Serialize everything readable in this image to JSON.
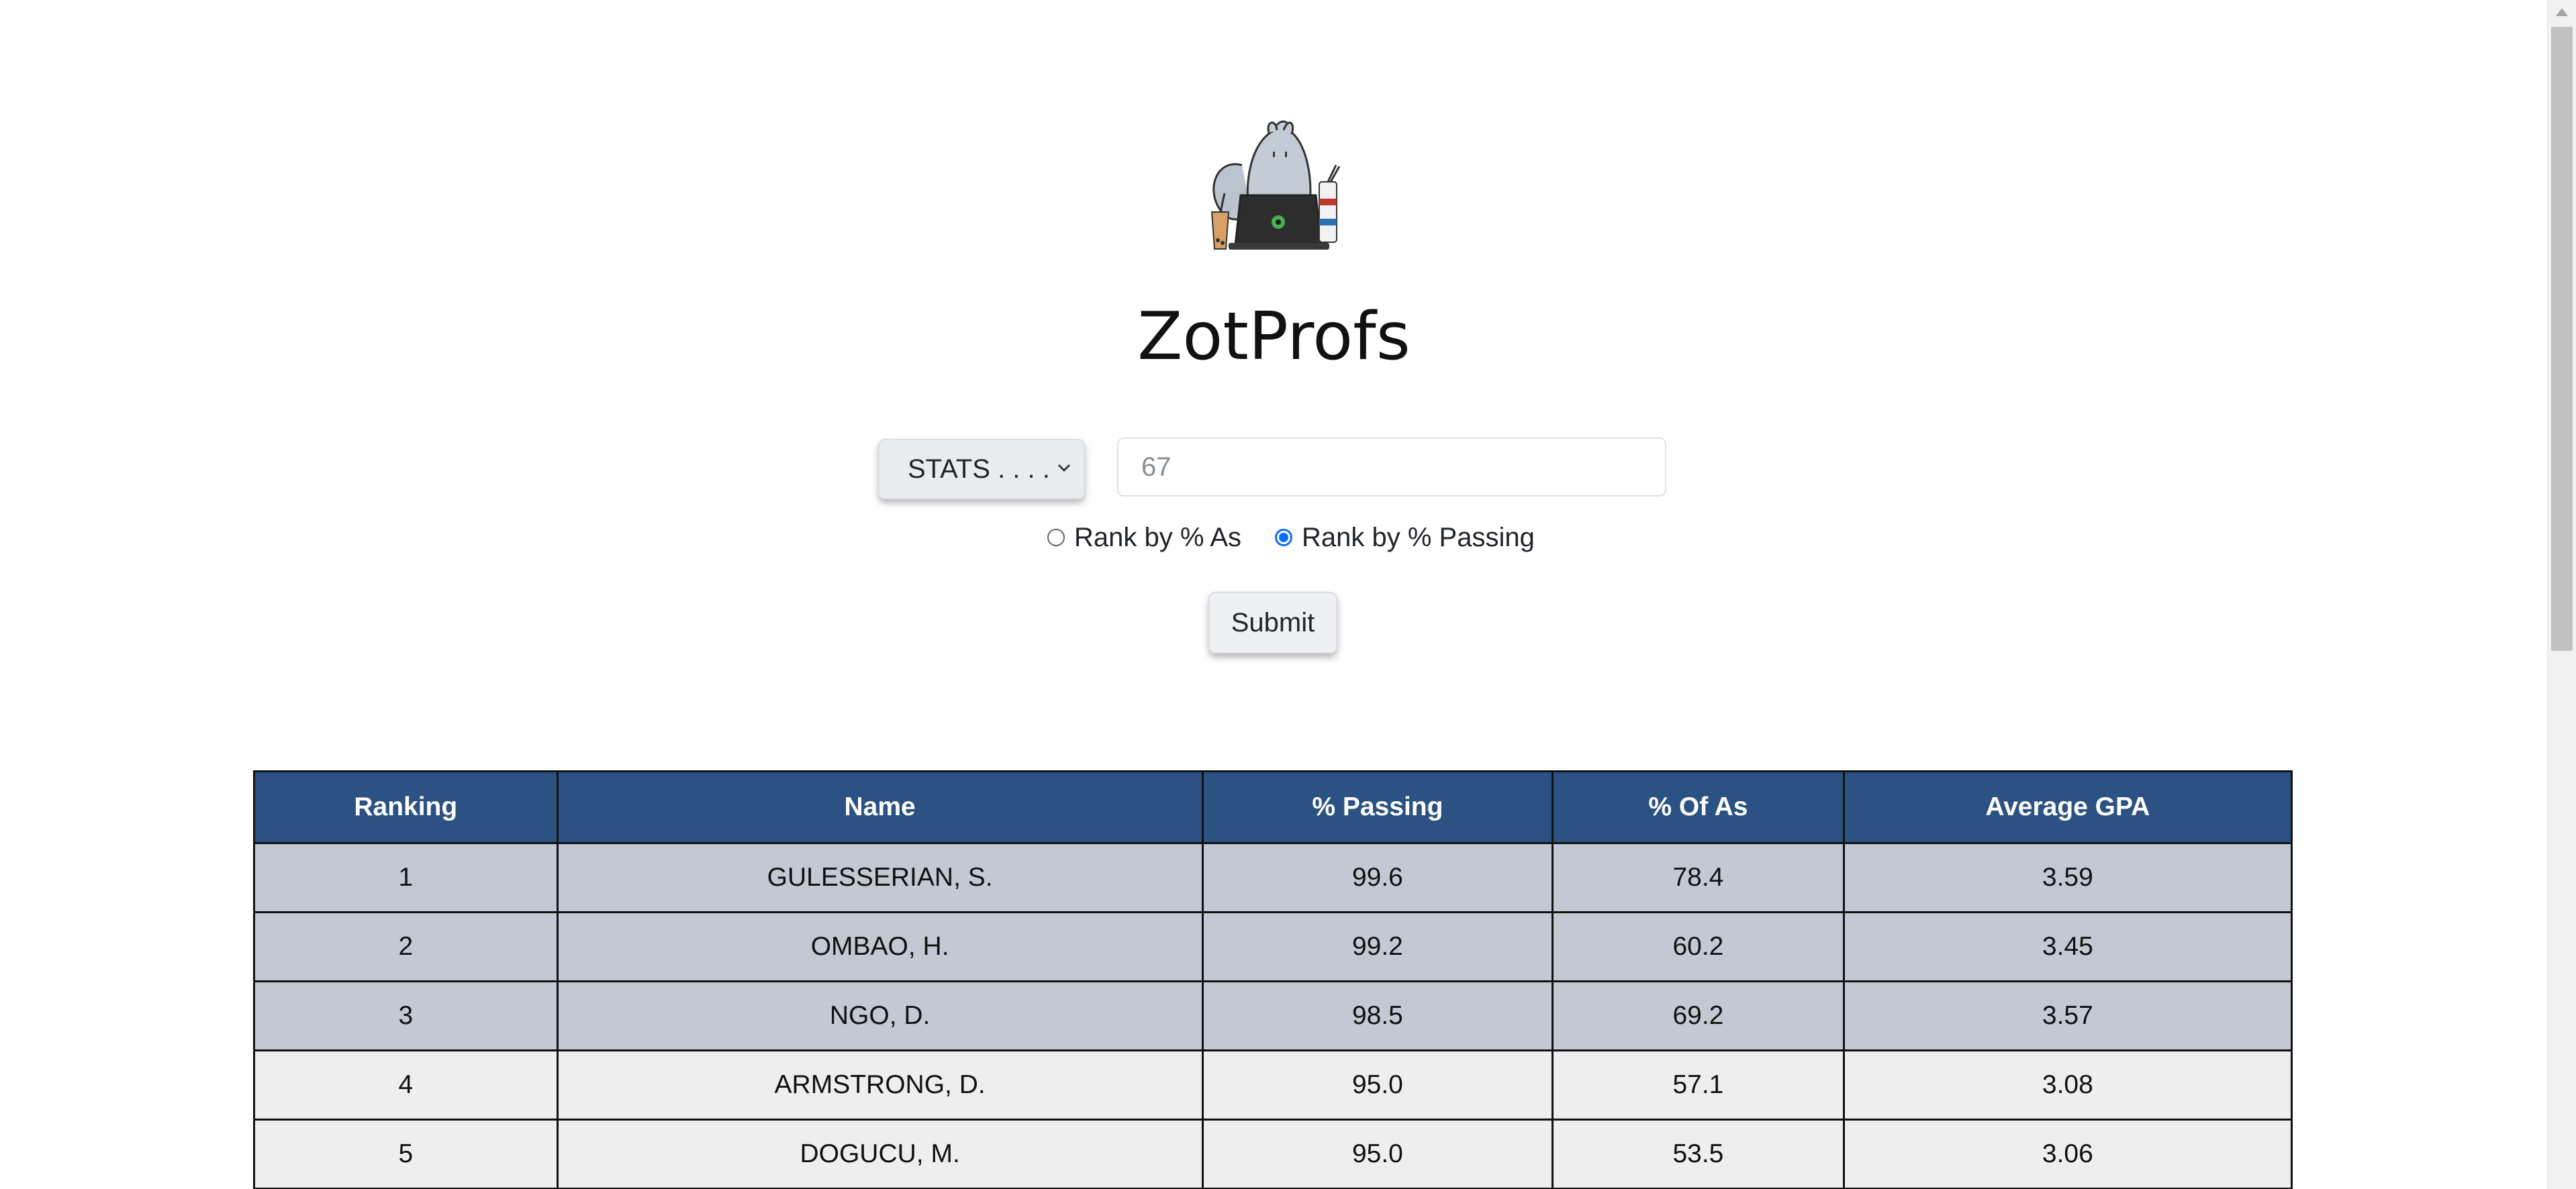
{
  "app": {
    "title": "ZotProfs",
    "logo_icon": "anteater-laptop-mascot-icon"
  },
  "form": {
    "department_select": {
      "value": "STATS . . . ."
    },
    "course_input": {
      "placeholder": "67",
      "value": ""
    },
    "radios": [
      {
        "label": "Rank by % As",
        "checked": false
      },
      {
        "label": "Rank by % Passing",
        "checked": true
      }
    ],
    "submit_label": "Submit"
  },
  "table": {
    "headers": [
      "Ranking",
      "Name",
      "% Passing",
      "% Of As",
      "Average GPA"
    ],
    "rows": [
      [
        "1",
        "GULESSERIAN, S.",
        "99.6",
        "78.4",
        "3.59"
      ],
      [
        "2",
        "OMBAO, H.",
        "99.2",
        "60.2",
        "3.45"
      ],
      [
        "3",
        "NGO, D.",
        "98.5",
        "69.2",
        "3.57"
      ],
      [
        "4",
        "ARMSTRONG, D.",
        "95.0",
        "57.1",
        "3.08"
      ],
      [
        "5",
        "DOGUCU, M.",
        "95.0",
        "53.5",
        "3.06"
      ]
    ]
  },
  "colors": {
    "header_bg": "#2b5282",
    "top_row_bg": "#c3c9d3",
    "row_bg": "#eeeeee",
    "radio_accent": "#0d6efd"
  }
}
